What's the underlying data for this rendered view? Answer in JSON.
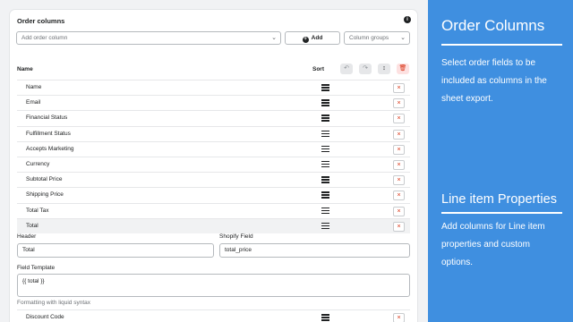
{
  "card": {
    "title": "Order columns",
    "add_placeholder": "Add order column",
    "add_button": "Add",
    "groups_placeholder": "Column groups",
    "col_name": "Name",
    "col_sort": "Sort",
    "rows": [
      {
        "label": "Name"
      },
      {
        "label": "Email"
      },
      {
        "label": "Financial Status"
      },
      {
        "label": "Fulfillment Status"
      },
      {
        "label": "Accepts Marketing"
      },
      {
        "label": "Currency"
      },
      {
        "label": "Subtotal Price"
      },
      {
        "label": "Shipping Price"
      },
      {
        "label": "Total Tax"
      },
      {
        "label": "Total"
      }
    ],
    "editor": {
      "header_label": "Header",
      "header_value": "Total",
      "shopify_label": "Shopify Field",
      "shopify_value": "total_price",
      "template_label": "Field Template",
      "template_value": "{{ total }}",
      "help": "Formatting with liquid syntax"
    },
    "after_row": {
      "label": "Discount Code"
    }
  },
  "panel": {
    "color": "#3f8fe0",
    "title1": "Order Columns",
    "text1": "Select order fields to be included as columns in the sheet export.",
    "title2": "Line item Properties",
    "text2": "Add columns for Line item properties and custom options."
  }
}
